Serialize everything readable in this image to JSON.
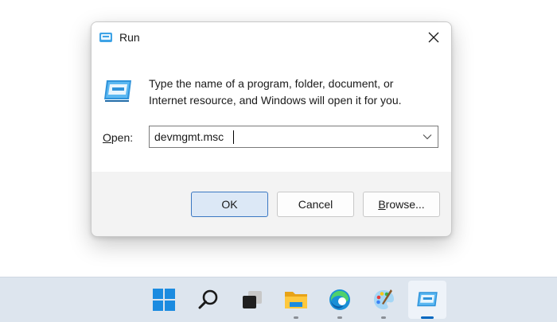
{
  "window": {
    "title": "Run",
    "close_label": "✕"
  },
  "dialog": {
    "description_line1": "Type the name of a program, folder, document, or",
    "description_line2": "Internet resource, and Windows will open it for you.",
    "open_label_prefix": "",
    "open_label_accel": "O",
    "open_label_rest": "pen:",
    "open_value": "devmgmt.msc"
  },
  "buttons": {
    "ok": "OK",
    "cancel": "Cancel",
    "browse_accel": "B",
    "browse_rest": "rowse..."
  },
  "taskbar": {
    "items": [
      {
        "name": "start-button",
        "icon": "windows-logo-icon"
      },
      {
        "name": "search-button",
        "icon": "search-icon"
      },
      {
        "name": "task-view-button",
        "icon": "task-view-icon"
      },
      {
        "name": "file-explorer-button",
        "icon": "folder-icon"
      },
      {
        "name": "edge-button",
        "icon": "edge-icon"
      },
      {
        "name": "paint-button",
        "icon": "paint-palette-icon"
      },
      {
        "name": "run-button",
        "icon": "run-icon",
        "active": true
      }
    ]
  },
  "colors": {
    "accent": "#0067c0",
    "ok_button_border": "#3b78c2",
    "ok_button_fill": "#dce8f6",
    "taskbar": "#dde5ee"
  }
}
